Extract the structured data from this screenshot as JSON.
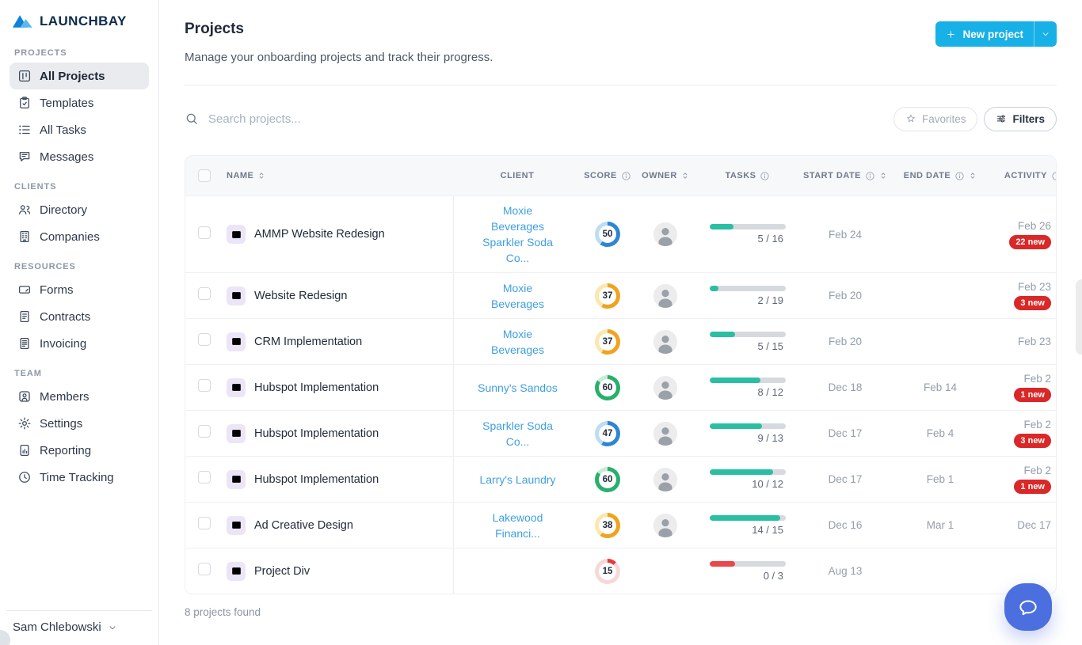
{
  "brand": {
    "name": "LAUNCHBAY"
  },
  "sidebar": {
    "sections": [
      {
        "label": "PROJECTS",
        "items": [
          {
            "label": "All Projects",
            "icon": "kanban",
            "active": true
          },
          {
            "label": "Templates",
            "icon": "clipboard",
            "active": false
          },
          {
            "label": "All Tasks",
            "icon": "list",
            "active": false
          },
          {
            "label": "Messages",
            "icon": "message",
            "active": false
          }
        ]
      },
      {
        "label": "CLIENTS",
        "items": [
          {
            "label": "Directory",
            "icon": "users",
            "active": false
          },
          {
            "label": "Companies",
            "icon": "building",
            "active": false
          }
        ]
      },
      {
        "label": "RESOURCES",
        "items": [
          {
            "label": "Forms",
            "icon": "form",
            "active": false
          },
          {
            "label": "Contracts",
            "icon": "contract",
            "active": false
          },
          {
            "label": "Invoicing",
            "icon": "invoice",
            "active": false
          }
        ]
      },
      {
        "label": "TEAM",
        "items": [
          {
            "label": "Members",
            "icon": "member",
            "active": false
          },
          {
            "label": "Settings",
            "icon": "gear",
            "active": false
          },
          {
            "label": "Reporting",
            "icon": "report",
            "active": false
          },
          {
            "label": "Time Tracking",
            "icon": "clock",
            "active": false
          }
        ]
      }
    ],
    "user": {
      "name": "Sam Chlebowski"
    }
  },
  "header": {
    "title": "Projects",
    "subtitle": "Manage your onboarding projects and track their progress.",
    "new_project": {
      "label": "New project"
    }
  },
  "toolbar": {
    "search_placeholder": "Search projects...",
    "favorites_label": "Favorites",
    "filters_label": "Filters"
  },
  "table": {
    "columns": [
      {
        "type": "checkbox",
        "label": ""
      },
      {
        "label": "NAME",
        "sort": true
      },
      {
        "label": "CLIENT"
      },
      {
        "label": "SCORE",
        "info": true
      },
      {
        "label": "OWNER",
        "sort": true
      },
      {
        "label": "TASKS",
        "info": true
      },
      {
        "label": "START DATE",
        "info": true,
        "sort": true
      },
      {
        "label": "END DATE",
        "info": true,
        "sort": true
      },
      {
        "label": "ACTIVITY",
        "info": true
      }
    ],
    "rows": [
      {
        "name": "AMMP Website Redesign",
        "clients": [
          "Moxie Beverages",
          "Sparkler Soda Co..."
        ],
        "score": {
          "value": 50,
          "pct": 60,
          "color": "#2e86d3",
          "track": "#bdddf5"
        },
        "owner": true,
        "tasks": {
          "done": 5,
          "total": 16,
          "pct": 31,
          "color": "#2abfa3"
        },
        "start_date": "Feb 24",
        "end_date": "",
        "activity_date": "Feb 26",
        "activity_badge": "22 new"
      },
      {
        "name": "Website Redesign",
        "clients": [
          "Moxie Beverages"
        ],
        "score": {
          "value": 37,
          "pct": 58,
          "color": "#f0a31f",
          "track": "#fbe7b0"
        },
        "owner": true,
        "tasks": {
          "done": 2,
          "total": 19,
          "pct": 11,
          "color": "#2abfa3"
        },
        "start_date": "Feb 20",
        "end_date": "",
        "activity_date": "Feb 23",
        "activity_badge": "3 new"
      },
      {
        "name": "CRM Implementation",
        "clients": [
          "Moxie Beverages"
        ],
        "score": {
          "value": 37,
          "pct": 58,
          "color": "#f0a31f",
          "track": "#fbe7b0"
        },
        "owner": true,
        "tasks": {
          "done": 5,
          "total": 15,
          "pct": 33,
          "color": "#2abfa3"
        },
        "start_date": "Feb 20",
        "end_date": "",
        "activity_date": "Feb 23",
        "activity_badge": ""
      },
      {
        "name": "Hubspot Implementation",
        "clients": [
          "Sunny's Sandos"
        ],
        "score": {
          "value": 60,
          "pct": 85,
          "color": "#27b06c",
          "track": "#c8ecd9"
        },
        "owner": true,
        "tasks": {
          "done": 8,
          "total": 12,
          "pct": 67,
          "color": "#2abfa3"
        },
        "start_date": "Dec 18",
        "end_date": "Feb 14",
        "activity_date": "Feb 2",
        "activity_badge": "1 new"
      },
      {
        "name": "Hubspot Implementation",
        "clients": [
          "Sparkler Soda Co..."
        ],
        "score": {
          "value": 47,
          "pct": 58,
          "color": "#2e86d3",
          "track": "#bdddf5"
        },
        "owner": true,
        "tasks": {
          "done": 9,
          "total": 13,
          "pct": 69,
          "color": "#2abfa3"
        },
        "start_date": "Dec 17",
        "end_date": "Feb 4",
        "activity_date": "Feb 2",
        "activity_badge": "3 new"
      },
      {
        "name": "Hubspot Implementation",
        "clients": [
          "Larry's Laundry"
        ],
        "score": {
          "value": 60,
          "pct": 85,
          "color": "#27b06c",
          "track": "#c8ecd9"
        },
        "owner": true,
        "tasks": {
          "done": 10,
          "total": 12,
          "pct": 83,
          "color": "#2abfa3"
        },
        "start_date": "Dec 17",
        "end_date": "Feb 1",
        "activity_date": "Feb 2",
        "activity_badge": "1 new"
      },
      {
        "name": "Ad Creative Design",
        "clients": [
          "Lakewood Financi..."
        ],
        "score": {
          "value": 38,
          "pct": 60,
          "color": "#f0a31f",
          "track": "#fbe7b0"
        },
        "owner": true,
        "tasks": {
          "done": 14,
          "total": 15,
          "pct": 93,
          "color": "#2abfa3"
        },
        "start_date": "Dec 16",
        "end_date": "Mar 1",
        "activity_date": "Dec 17",
        "activity_badge": ""
      },
      {
        "name": "Project Div",
        "clients": [],
        "score": {
          "value": 15,
          "pct": 12,
          "color": "#e23d3a",
          "track": "#f8d8d6"
        },
        "owner": false,
        "tasks": {
          "done": 0,
          "total": 3,
          "pct": 33,
          "color": "#e8474b"
        },
        "start_date": "Aug 13",
        "end_date": "",
        "activity_date": "",
        "activity_badge": ""
      }
    ]
  },
  "footer": {
    "results_text": "8 projects found"
  },
  "colors": {
    "accent": "#17b0e7",
    "link": "#3f9fe0",
    "progress_teal": "#2abfa3",
    "progress_red": "#e8474b",
    "badge_red": "#da2727",
    "chat_fab": "#4b6fdf",
    "score_blue": "#2e86d3",
    "score_orange": "#f0a31f",
    "score_green": "#27b06c",
    "score_red": "#e23d3a"
  }
}
